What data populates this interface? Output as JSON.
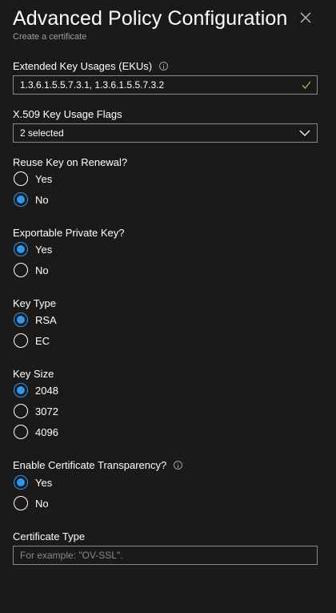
{
  "header": {
    "title": "Advanced Policy Configuration",
    "subtitle": "Create a certificate"
  },
  "ekus": {
    "label": "Extended Key Usages (EKUs)",
    "value": "1.3.6.1.5.5.7.3.1, 1.3.6.1.5.5.7.3.2"
  },
  "key_usage": {
    "label": "X.509 Key Usage Flags",
    "value": "2 selected"
  },
  "reuse_key": {
    "label": "Reuse Key on Renewal?",
    "options": [
      {
        "label": "Yes",
        "checked": false
      },
      {
        "label": "No",
        "checked": true
      }
    ]
  },
  "exportable": {
    "label": "Exportable Private Key?",
    "options": [
      {
        "label": "Yes",
        "checked": true
      },
      {
        "label": "No",
        "checked": false
      }
    ]
  },
  "key_type": {
    "label": "Key Type",
    "options": [
      {
        "label": "RSA",
        "checked": true
      },
      {
        "label": "EC",
        "checked": false
      }
    ]
  },
  "key_size": {
    "label": "Key Size",
    "options": [
      {
        "label": "2048",
        "checked": true
      },
      {
        "label": "3072",
        "checked": false
      },
      {
        "label": "4096",
        "checked": false
      }
    ]
  },
  "transparency": {
    "label": "Enable Certificate Transparency?",
    "options": [
      {
        "label": "Yes",
        "checked": true
      },
      {
        "label": "No",
        "checked": false
      }
    ]
  },
  "cert_type": {
    "label": "Certificate Type",
    "value": "",
    "placeholder": "For example: \"OV-SSL\"."
  },
  "colors": {
    "background": "#1b1a19",
    "accent": "#2899f5",
    "valid": "#92c353",
    "border": "#8a8886"
  }
}
